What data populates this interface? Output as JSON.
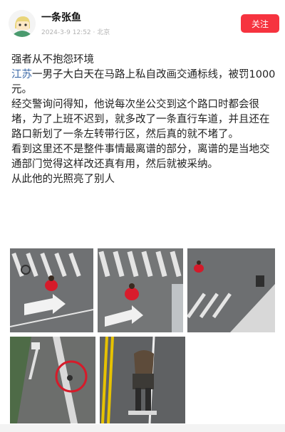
{
  "header": {
    "username": "一条张鱼",
    "meta": "2024-3-9 12:52 · 北京",
    "follow_label": "关注"
  },
  "post": {
    "line1": "强者从不抱怨环境",
    "line2_link": "江苏",
    "line2_rest": "一男子大白天在马路上私自改画交通标线，被罚1000元。",
    "line3": "经交警询问得知，他说每次坐公交到这个路口时都会很堵，为了上班不迟到，就多改了一条直行车道，并且还在路口新划了一条左转带行区，然后真的就不堵了。",
    "line4": "看到这里还不是整件事情最离谱的部分，离谱的是当地交通部门觉得这样改还真有用，然后就被采纳。",
    "line5": "从此他的光照亮了别人"
  },
  "images": [
    {
      "name": "photo-1"
    },
    {
      "name": "photo-2"
    },
    {
      "name": "photo-3"
    },
    {
      "name": "photo-4"
    },
    {
      "name": "photo-5"
    }
  ],
  "colors": {
    "follow_bg": "#f6333f",
    "link": "#3e6ba8"
  }
}
